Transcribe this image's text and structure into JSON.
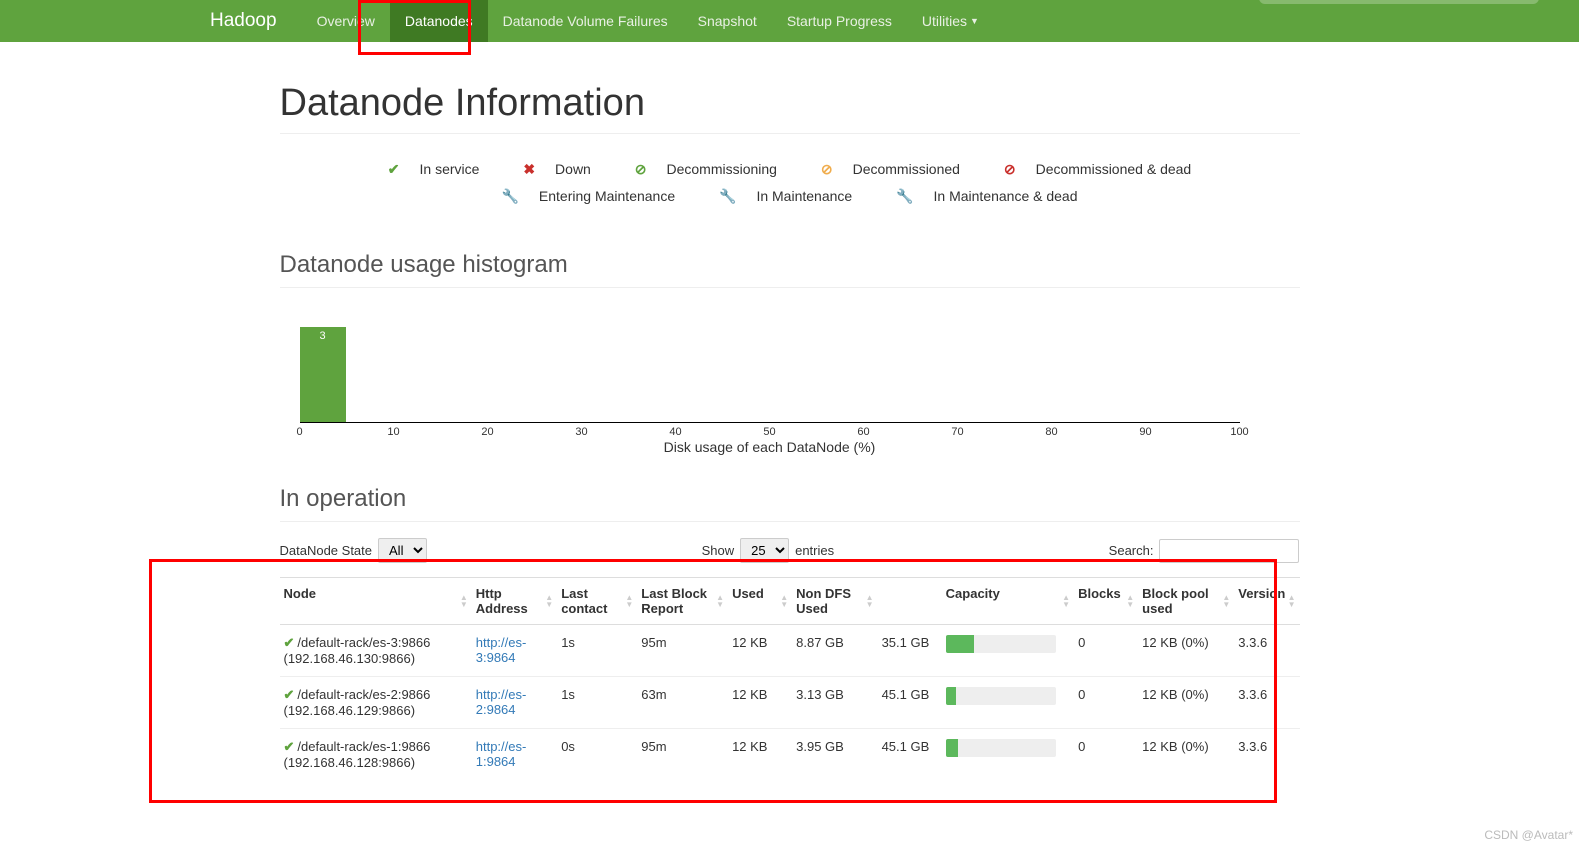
{
  "brand": "Hadoop",
  "nav": [
    {
      "label": "Overview",
      "active": false
    },
    {
      "label": "Datanodes",
      "active": true
    },
    {
      "label": "Datanode Volume Failures",
      "active": false
    },
    {
      "label": "Snapshot",
      "active": false
    },
    {
      "label": "Startup Progress",
      "active": false
    },
    {
      "label": "Utilities",
      "active": false,
      "dropdown": true
    }
  ],
  "page_title": "Datanode Information",
  "legend": {
    "in_service": "In service",
    "down": "Down",
    "decommissioning": "Decommissioning",
    "decommissioned": "Decommissioned",
    "decom_dead": "Decommissioned & dead",
    "entering_maint": "Entering Maintenance",
    "in_maint": "In Maintenance",
    "in_maint_dead": "In Maintenance & dead"
  },
  "histogram_title": "Datanode usage histogram",
  "chart_data": {
    "type": "bar",
    "categories": [
      0,
      10,
      20,
      30,
      40,
      50,
      60,
      70,
      80,
      90,
      100
    ],
    "values": [
      3,
      0,
      0,
      0,
      0,
      0,
      0,
      0,
      0,
      0
    ],
    "xlabel": "Disk usage of each DataNode (%)",
    "ylabel": "",
    "ylim": [
      0,
      3
    ]
  },
  "in_operation_title": "In operation",
  "controls": {
    "state_label": "DataNode State",
    "state_value": "All",
    "show_label": "Show",
    "show_value": "25",
    "entries_label": "entries",
    "search_label": "Search:",
    "search_value": ""
  },
  "columns": {
    "node": "Node",
    "http": "Http Address",
    "lastc": "Last contact",
    "lastb": "Last Block Report",
    "used": "Used",
    "nondfs": "Non DFS Used",
    "capacity": "Capacity",
    "blocks": "Blocks",
    "pool": "Block pool used",
    "version": "Version"
  },
  "rows": [
    {
      "node_top": "/default-rack/es-3:9866",
      "node_bot": "(192.168.46.130:9866)",
      "http": "http://es-3:9864",
      "lastc": "1s",
      "lastb": "95m",
      "used": "12 KB",
      "nondfs": "8.87 GB",
      "cap_text": "35.1 GB",
      "cap_pct": 26,
      "blocks": "0",
      "pool": "12 KB (0%)",
      "version": "3.3.6"
    },
    {
      "node_top": "/default-rack/es-2:9866",
      "node_bot": "(192.168.46.129:9866)",
      "http": "http://es-2:9864",
      "lastc": "1s",
      "lastb": "63m",
      "used": "12 KB",
      "nondfs": "3.13 GB",
      "cap_text": "45.1 GB",
      "cap_pct": 9,
      "blocks": "0",
      "pool": "12 KB (0%)",
      "version": "3.3.6"
    },
    {
      "node_top": "/default-rack/es-1:9866",
      "node_bot": "(192.168.46.128:9866)",
      "http": "http://es-1:9864",
      "lastc": "0s",
      "lastb": "95m",
      "used": "12 KB",
      "nondfs": "3.95 GB",
      "cap_text": "45.1 GB",
      "cap_pct": 11,
      "blocks": "0",
      "pool": "12 KB (0%)",
      "version": "3.3.6"
    }
  ],
  "watermark": "CSDN @Avatar*"
}
